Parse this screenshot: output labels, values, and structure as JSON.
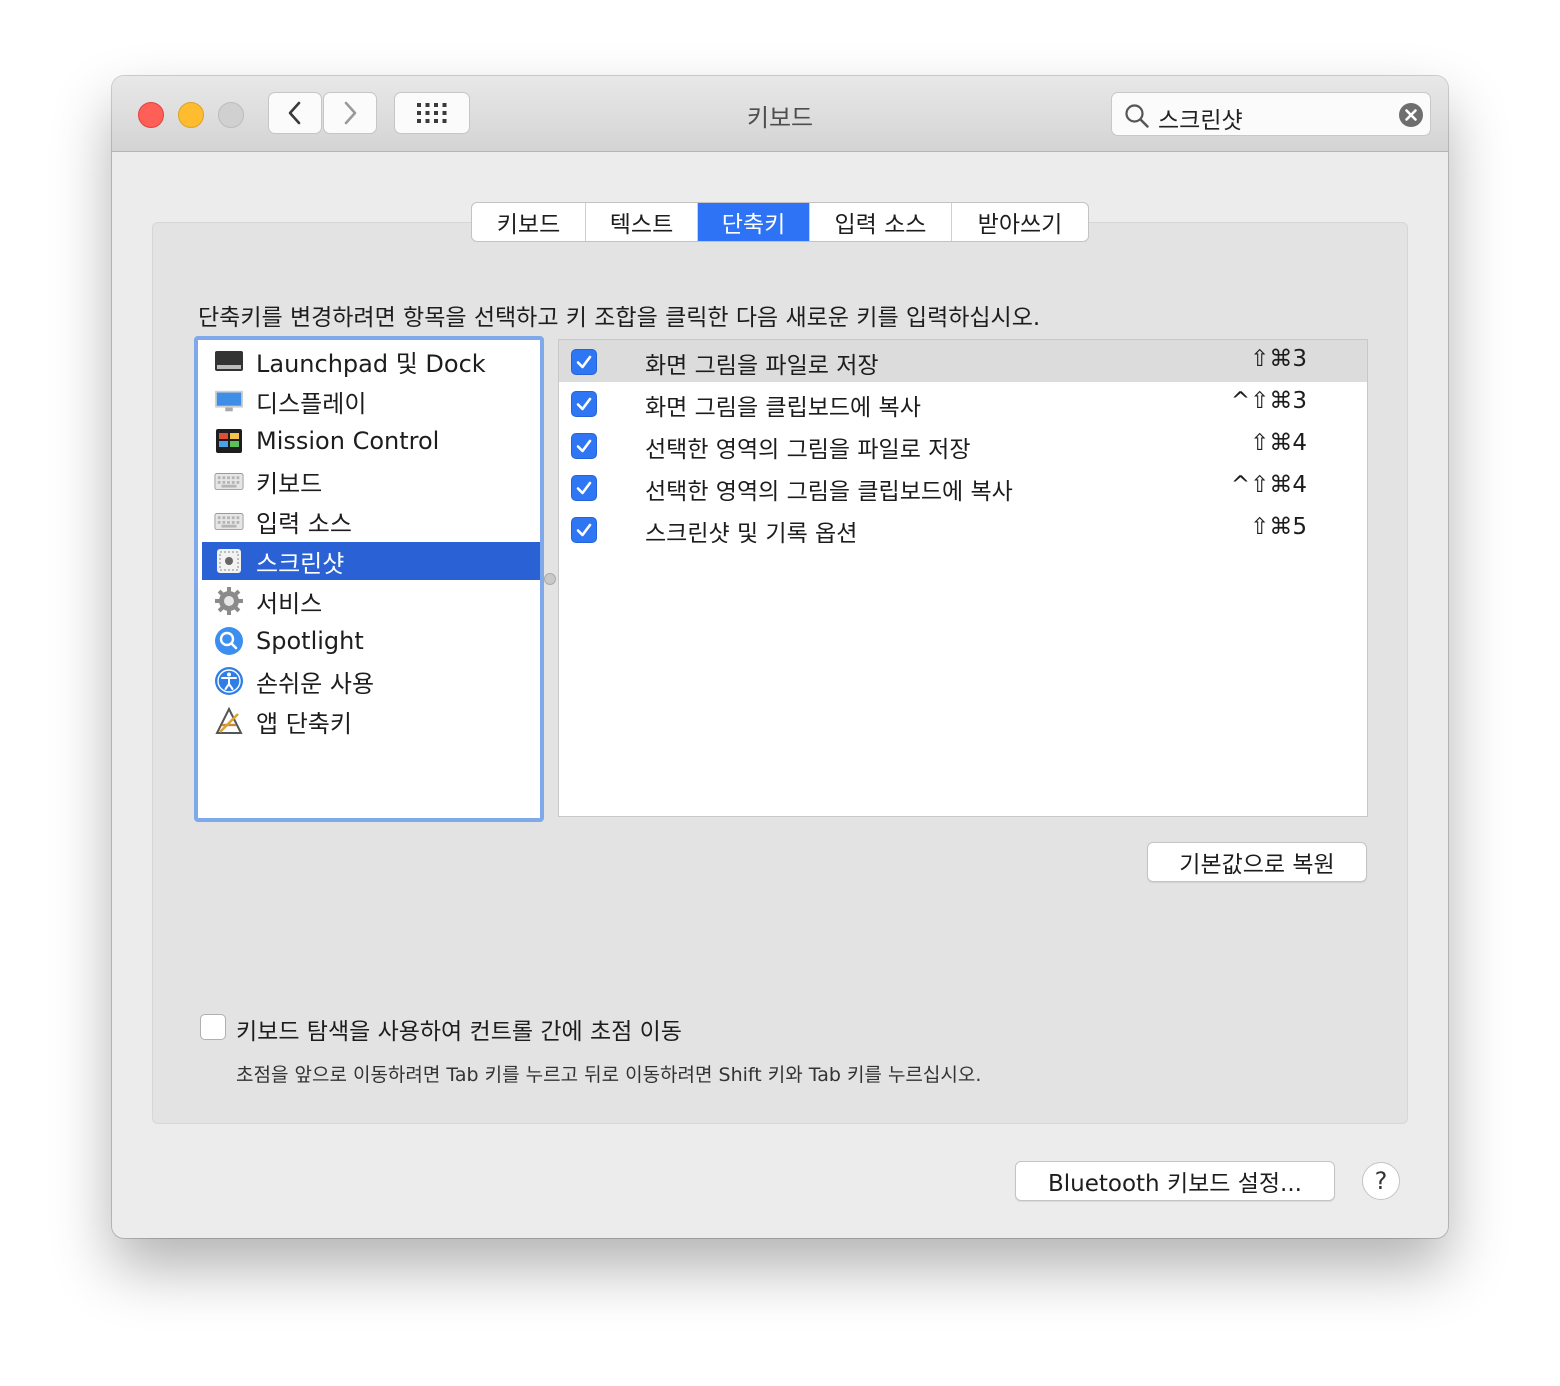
{
  "window": {
    "title": "키보드"
  },
  "search": {
    "value": "스크린샷"
  },
  "tabs": [
    {
      "label": "키보드"
    },
    {
      "label": "텍스트"
    },
    {
      "label": "단축키",
      "active": true
    },
    {
      "label": "입력 소스"
    },
    {
      "label": "받아쓰기"
    }
  ],
  "instruction": "단축키를 변경하려면 항목을 선택하고 키 조합을 클릭한 다음 새로운 키를 입력하십시오.",
  "categories": [
    {
      "label": "Launchpad 및 Dock",
      "icon": "launchpad-dock-icon"
    },
    {
      "label": "디스플레이",
      "icon": "display-icon"
    },
    {
      "label": "Mission Control",
      "icon": "mission-control-icon"
    },
    {
      "label": "키보드",
      "icon": "keyboard-icon"
    },
    {
      "label": "입력 소스",
      "icon": "keyboard-icon"
    },
    {
      "label": "스크린샷",
      "icon": "screenshot-icon",
      "selected": true
    },
    {
      "label": "서비스",
      "icon": "gear-icon"
    },
    {
      "label": "Spotlight",
      "icon": "spotlight-icon"
    },
    {
      "label": "손쉬운 사용",
      "icon": "accessibility-icon"
    },
    {
      "label": "앱 단축키",
      "icon": "app-shortcuts-icon"
    }
  ],
  "shortcuts": [
    {
      "label": "화면 그림을 파일로 저장",
      "keys": "⇧⌘3",
      "checked": true
    },
    {
      "label": "화면 그림을 클립보드에 복사",
      "keys": "^⇧⌘3",
      "checked": true
    },
    {
      "label": "선택한 영역의 그림을 파일로 저장",
      "keys": "⇧⌘4",
      "checked": true
    },
    {
      "label": "선택한 영역의 그림을 클립보드에 복사",
      "keys": "^⇧⌘4",
      "checked": true
    },
    {
      "label": "스크린샷 및 기록 옵션",
      "keys": "⇧⌘5",
      "checked": true
    }
  ],
  "restore_button": "기본값으로 복원",
  "keyboard_navigation": {
    "label": "키보드 탐색을 사용하여 컨트롤 간에 초점 이동",
    "hint": "초점을 앞으로 이동하려면 Tab 키를 누르고 뒤로 이동하려면 Shift 키와 Tab 키를 누르십시오.",
    "checked": false
  },
  "bluetooth_button": "Bluetooth 키보드 설정...",
  "help_button": "?",
  "colors": {
    "accent": "#2e73f5",
    "selection": "#2a62d6",
    "focus_ring": "#7fa9ea"
  }
}
